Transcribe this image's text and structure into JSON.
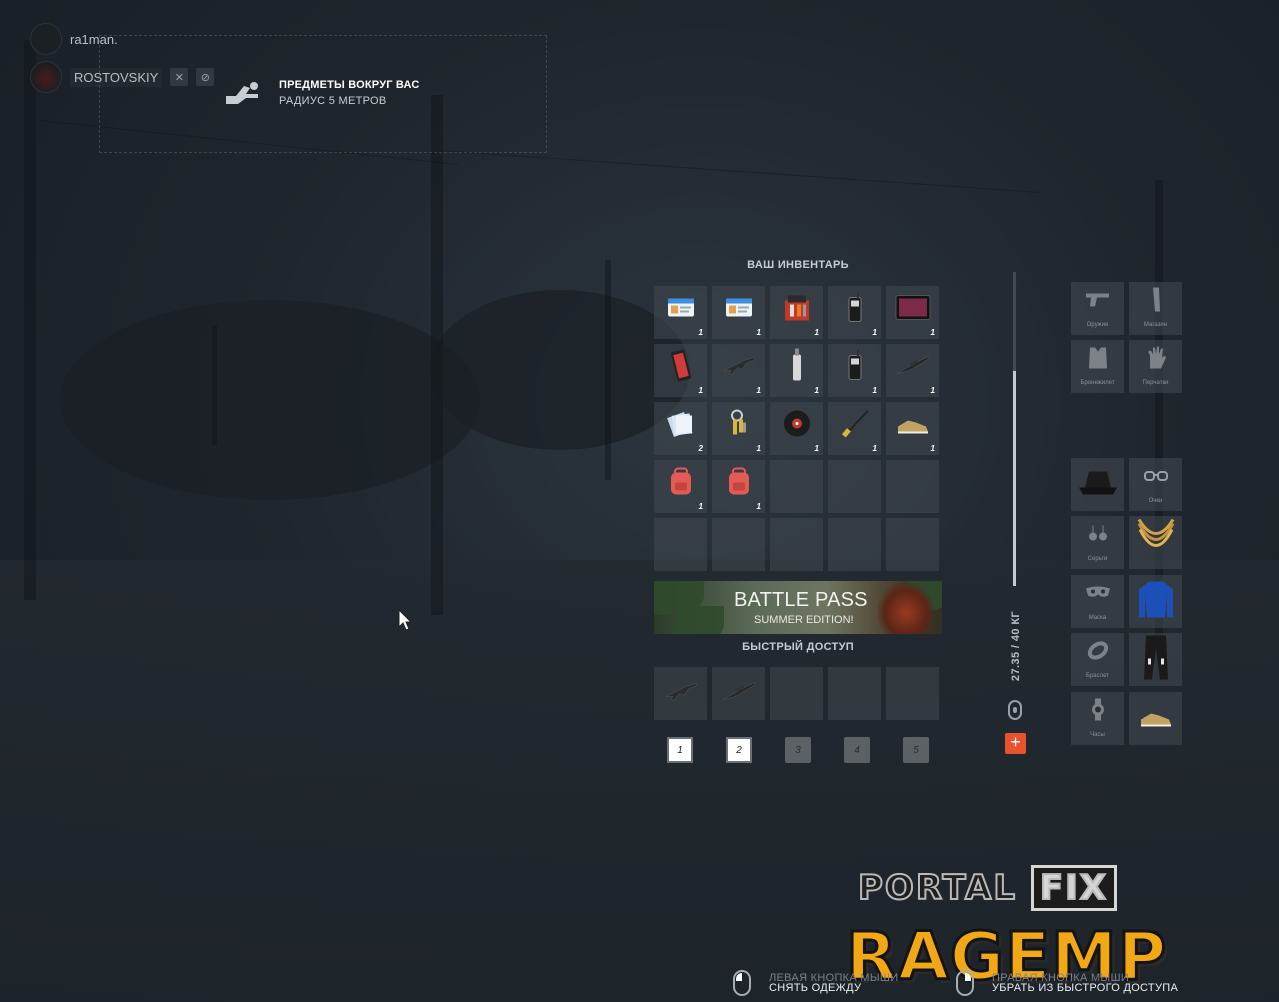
{
  "voice": [
    {
      "name": "ra1man."
    },
    {
      "name": "ROSTOVSKIY"
    }
  ],
  "nearby": {
    "title": "ПРЕДМЕТЫ ВОКРУГ ВАС",
    "subtitle": "РАДИУС 5 МЕТРОВ",
    "icon": "hand-icon"
  },
  "inventory": {
    "title": "ВАШ ИНВЕНТАРЬ",
    "slots": [
      {
        "icon": "id-card-icon",
        "qty": "1"
      },
      {
        "icon": "id-card-icon",
        "qty": "1"
      },
      {
        "icon": "toolbox-icon",
        "qty": "1"
      },
      {
        "icon": "radio-icon",
        "qty": "1"
      },
      {
        "icon": "tablet-icon",
        "qty": "1"
      },
      {
        "icon": "phone-icon",
        "qty": "1"
      },
      {
        "icon": "rifle-icon",
        "qty": "1"
      },
      {
        "icon": "canister-icon",
        "qty": "1"
      },
      {
        "icon": "radio-icon",
        "qty": "1"
      },
      {
        "icon": "sniper-icon",
        "qty": "1"
      },
      {
        "icon": "papers-icon",
        "qty": "2"
      },
      {
        "icon": "keys-icon",
        "qty": "1"
      },
      {
        "icon": "vinyl-icon",
        "qty": "1"
      },
      {
        "icon": "fishing-rod-icon",
        "qty": "1"
      },
      {
        "icon": "shoes-icon",
        "qty": "1"
      },
      {
        "icon": "backpack-icon",
        "qty": "1"
      },
      {
        "icon": "backpack-icon",
        "qty": "1"
      },
      {
        "icon": "",
        "qty": ""
      },
      {
        "icon": "",
        "qty": ""
      },
      {
        "icon": "",
        "qty": ""
      },
      {
        "icon": "",
        "qty": ""
      },
      {
        "icon": "",
        "qty": ""
      },
      {
        "icon": "",
        "qty": ""
      },
      {
        "icon": "",
        "qty": ""
      },
      {
        "icon": "",
        "qty": ""
      }
    ]
  },
  "battle_pass": {
    "title": "BATTLE PASS",
    "subtitle": "SUMMER EDITION!"
  },
  "quick_access": {
    "title": "БЫСТРЫЙ ДОСТУП",
    "slots": [
      {
        "icon": "rifle-icon"
      },
      {
        "icon": "sniper-icon"
      },
      {
        "icon": ""
      },
      {
        "icon": ""
      },
      {
        "icon": ""
      }
    ],
    "keys": [
      {
        "label": "1",
        "active": true
      },
      {
        "label": "2",
        "active": true
      },
      {
        "label": "3",
        "active": false
      },
      {
        "label": "4",
        "active": false
      },
      {
        "label": "5",
        "active": false
      }
    ]
  },
  "weight": {
    "text": "27.35 / 40 КГ",
    "current": 27.35,
    "max": 40,
    "add_label": "+"
  },
  "equipment": {
    "top": [
      {
        "label": "Оружие",
        "icon": "pistol-icon"
      },
      {
        "label": "Магазин",
        "icon": "magazine-icon"
      },
      {
        "label": "Бронежилет",
        "icon": "vest-icon"
      },
      {
        "label": "Перчатки",
        "icon": "glove-icon"
      }
    ],
    "clothes": [
      {
        "label": "",
        "icon": "bucket-hat-icon"
      },
      {
        "label": "Очки",
        "icon": "glasses-icon"
      },
      {
        "label": "Серьги",
        "icon": "earrings-icon"
      },
      {
        "label": "",
        "icon": "gold-chain-icon"
      },
      {
        "label": "Маска",
        "icon": "mask-icon"
      },
      {
        "label": "",
        "icon": "blue-jacket-icon"
      },
      {
        "label": "Браслет",
        "icon": "bracelet-icon"
      },
      {
        "label": "",
        "icon": "pants-icon"
      },
      {
        "label": "Часы",
        "icon": "watch-icon"
      },
      {
        "label": "",
        "icon": "shoes-icon"
      }
    ]
  },
  "hints": [
    {
      "top": "ЛЕВАЯ КНОПКА МЫШИ",
      "bottom": "СНЯТЬ ОДЕЖДУ"
    },
    {
      "top": "ПРАВАЯ КНОПКА МЫШИ",
      "bottom": "УБРАТЬ ИЗ БЫСТРОГО ДОСТУПА"
    }
  ],
  "watermark": {
    "line1_a": "PORTAL",
    "line1_b": "FIX",
    "line2": "RAGEMP"
  },
  "colors": {
    "accent": "#e8522d",
    "watermark": "#f2a815"
  }
}
